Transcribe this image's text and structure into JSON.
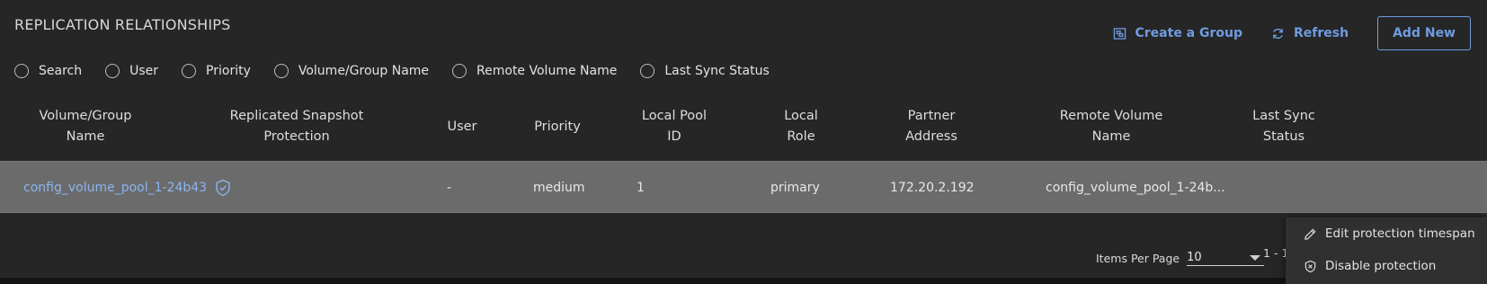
{
  "page": {
    "title": "REPLICATION RELATIONSHIPS"
  },
  "actions": {
    "create_group": "Create a Group",
    "refresh": "Refresh",
    "add_new": "Add New",
    "link_color": "#6f9ce0"
  },
  "filters": [
    {
      "label": "Search"
    },
    {
      "label": "User"
    },
    {
      "label": "Priority"
    },
    {
      "label": "Volume/Group Name"
    },
    {
      "label": "Remote Volume Name"
    },
    {
      "label": "Last Sync Status"
    }
  ],
  "table": {
    "columns": [
      {
        "line1": "Volume/Group",
        "line2": "Name"
      },
      {
        "line1": "Replicated Snapshot",
        "line2": "Protection"
      },
      {
        "line1": "User",
        "line2": ""
      },
      {
        "line1": "Priority",
        "line2": ""
      },
      {
        "line1": "Local Pool",
        "line2": "ID"
      },
      {
        "line1": "Local",
        "line2": "Role"
      },
      {
        "line1": "Partner",
        "line2": "Address"
      },
      {
        "line1": "Remote Volume",
        "line2": "Name"
      },
      {
        "line1": "Last Sync",
        "line2": "Status"
      }
    ],
    "rows": [
      {
        "name": "config_volume_pool_1-24b43",
        "protection_icon": "shield-check-icon",
        "user": "-",
        "priority": "medium",
        "local_pool_id": "1",
        "local_role": "primary",
        "partner_address": "172.20.2.192",
        "remote_volume_name": "config_volume_pool_1-24b...",
        "last_sync_status": ""
      }
    ]
  },
  "pagination": {
    "items_per_page_label": "Items Per Page",
    "items_per_page_value": "10",
    "range": "1 - 1"
  },
  "context_menu": {
    "items": [
      {
        "label": "Edit protection timespan",
        "icon": "pencil-icon"
      },
      {
        "label": "Disable protection",
        "icon": "shield-x-icon"
      }
    ]
  }
}
